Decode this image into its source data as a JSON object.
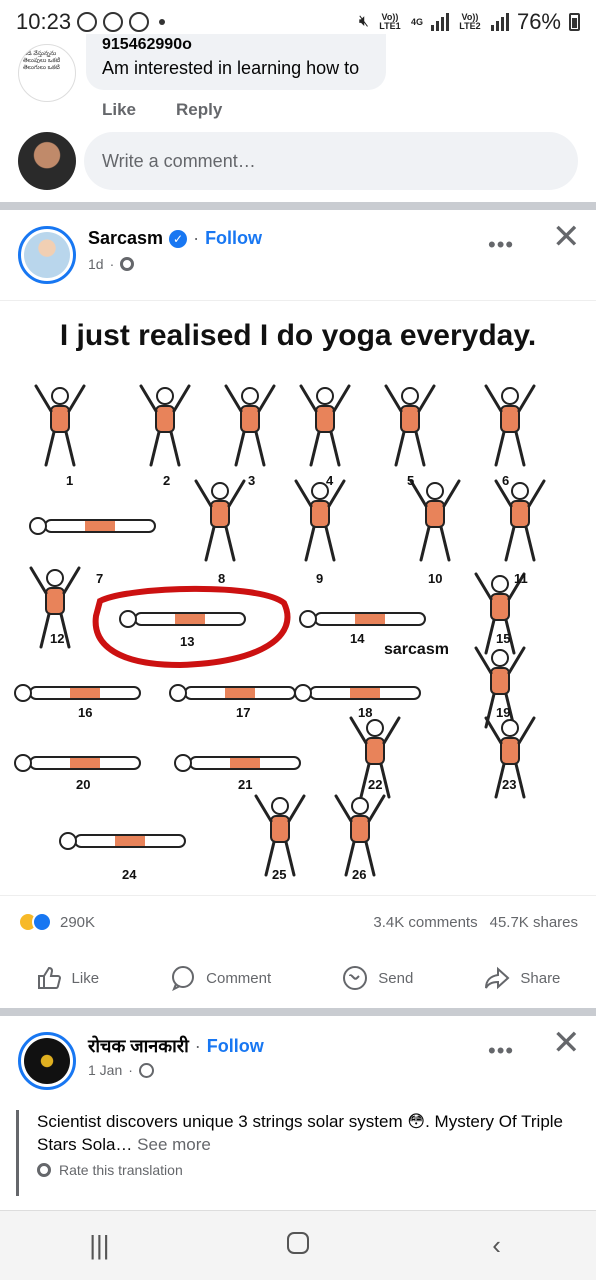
{
  "status_bar": {
    "time": "10:23",
    "battery": "76%",
    "network_1": "Vo)) LTE1",
    "network_2": "4G",
    "network_3": "Vo)) LTE2"
  },
  "comment": {
    "author_phone": "915462990o",
    "text": "Am interested in learning how to",
    "like_label": "Like",
    "reply_label": "Reply",
    "avatar_text": "పిడి వేస్తున్నను తెలుపులు ఒకటి తెలుగులు ఒకటి"
  },
  "write_comment": {
    "placeholder": "Write a comment…"
  },
  "post": {
    "page_name": "Sarcasm",
    "follow_label": "Follow",
    "time": "1d",
    "image_title": "I just realised I do yoga everyday.",
    "watermark": "sarcasm",
    "pose_numbers": [
      "1",
      "2",
      "3",
      "4",
      "5",
      "6",
      "7",
      "8",
      "9",
      "10",
      "11",
      "12",
      "13",
      "14",
      "15",
      "16",
      "17",
      "18",
      "19",
      "20",
      "21",
      "22",
      "23",
      "24",
      "25",
      "26"
    ],
    "highlighted_pose": "13",
    "reaction_count": "290K",
    "comments_count": "3.4K comments",
    "shares_count": "45.7K shares"
  },
  "actions": {
    "like": "Like",
    "comment": "Comment",
    "send": "Send",
    "share": "Share"
  },
  "post2": {
    "page_name": "रोचक जानकारी",
    "follow_label": "Follow",
    "time": "1 Jan",
    "text": "Scientist discovers unique 3 strings solar system 😳. Mystery Of Triple Stars Sola…",
    "see_more": "See more",
    "rate_translation": "Rate this translation"
  },
  "colors": {
    "accent": "#1877f2",
    "muted": "#65676b",
    "bubble": "#f0f2f5",
    "highlight_red": "#cc1111",
    "pose_fill": "#e8835a"
  }
}
